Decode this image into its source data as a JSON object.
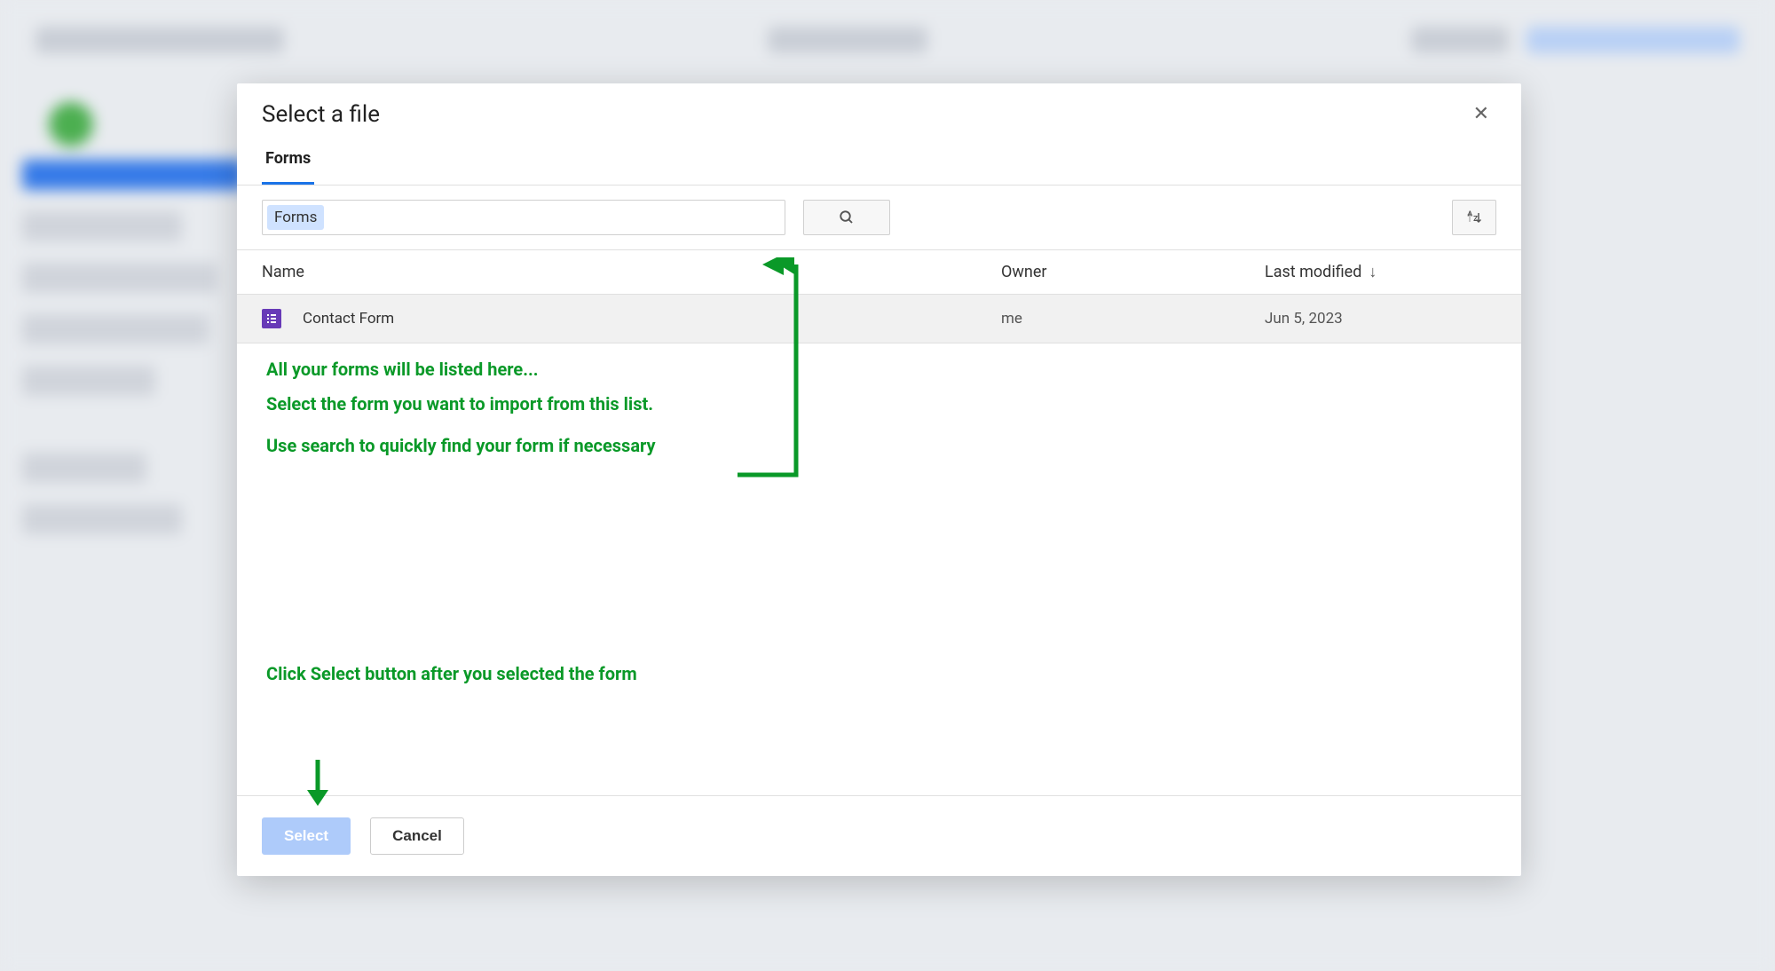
{
  "modal": {
    "title": "Select a file",
    "tabs": [
      {
        "label": "Forms"
      }
    ],
    "search_tag": "Forms",
    "columns": {
      "name": "Name",
      "owner": "Owner",
      "modified": "Last modified"
    },
    "rows": [
      {
        "name": "Contact Form",
        "owner": "me",
        "modified": "Jun 5, 2023"
      }
    ],
    "footer": {
      "select": "Select",
      "cancel": "Cancel"
    }
  },
  "annotations": {
    "line1": "All your forms will be listed here...",
    "line2": "Select the form you want to import from this list.",
    "line3": "Use search to quickly find your form if necessary",
    "line4": "Click Select button after you selected the form"
  }
}
